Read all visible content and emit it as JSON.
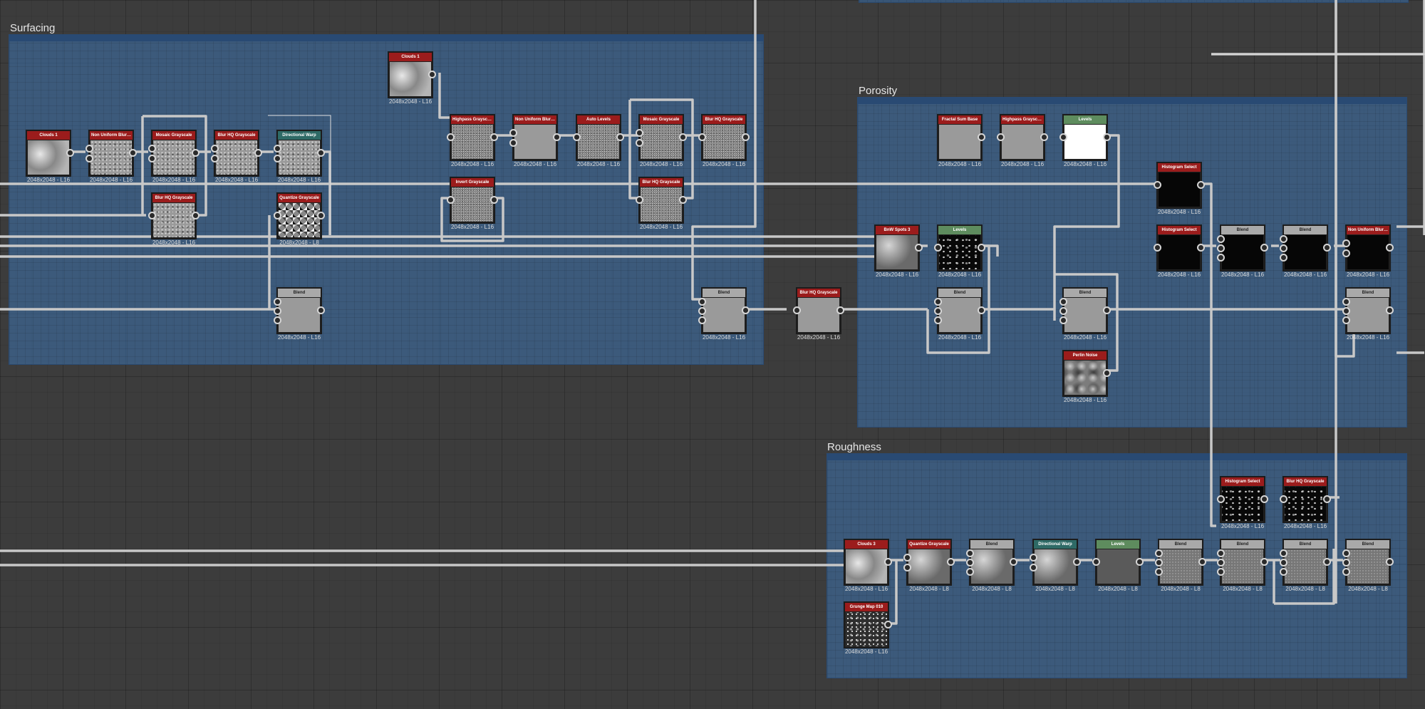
{
  "colors": {
    "canvas_bg": "#3c3c3c",
    "frame_fill": "#3c70a8",
    "wire": "#c8c8c8",
    "header_red": "#9b1c1c",
    "header_green": "#5e8c5e",
    "header_teal": "#2e6a66",
    "header_grey": "#a9a9a9"
  },
  "frames": [
    {
      "id": "surfacing",
      "title": "Surfacing"
    },
    {
      "id": "porosity",
      "title": "Porosity"
    },
    {
      "id": "roughness",
      "title": "Roughness"
    }
  ],
  "nodes": [
    {
      "id": "s_clouds1a",
      "label": "Clouds 1",
      "res": "2048x2048 - L16",
      "header": "red",
      "texture": "clouds"
    },
    {
      "id": "s_nublur1",
      "label": "Non Uniform Blur Grey...",
      "res": "2048x2048 - L16",
      "header": "red",
      "texture": "noise"
    },
    {
      "id": "s_mosaic1",
      "label": "Mosaic Grayscale",
      "res": "2048x2048 - L16",
      "header": "red",
      "texture": "noise"
    },
    {
      "id": "s_blurhq1",
      "label": "Blur HQ Grayscale",
      "res": "2048x2048 - L16",
      "header": "red",
      "texture": "noise"
    },
    {
      "id": "s_dirwarp",
      "label": "Directional Warp",
      "res": "2048x2048 - L16",
      "header": "teal",
      "texture": "noise"
    },
    {
      "id": "s_blurhq2",
      "label": "Blur HQ Grayscale",
      "res": "2048x2048 - L16",
      "header": "red",
      "texture": "noise"
    },
    {
      "id": "s_quantize",
      "label": "Quantize Grayscale",
      "res": "2048x2048 - L8",
      "header": "red",
      "texture": "cells"
    },
    {
      "id": "s_blend1",
      "label": "Blend",
      "res": "2048x2048 - L16",
      "header": "grey",
      "texture": "flat"
    },
    {
      "id": "s_clouds1b",
      "label": "Clouds 1",
      "res": "2048x2048 - L16",
      "header": "red",
      "texture": "clouds"
    },
    {
      "id": "s_highpass",
      "label": "Highpass Grayscale",
      "res": "2048x2048 - L16",
      "header": "red",
      "texture": "fine"
    },
    {
      "id": "s_invert",
      "label": "Invert Grayscale",
      "res": "2048x2048 - L16",
      "header": "red",
      "texture": "fine"
    },
    {
      "id": "s_nublur2",
      "label": "Non Uniform Blur Grey...",
      "res": "2048x2048 - L16",
      "header": "red",
      "texture": "flat"
    },
    {
      "id": "s_autolevels",
      "label": "Auto Levels",
      "res": "2048x2048 - L16",
      "header": "red",
      "texture": "fine"
    },
    {
      "id": "s_mosaic2",
      "label": "Mosaic Grayscale",
      "res": "2048x2048 - L16",
      "header": "red",
      "texture": "fine"
    },
    {
      "id": "s_blurhq3",
      "label": "Blur HQ Grayscale",
      "res": "2048x2048 - L16",
      "header": "red",
      "texture": "fine"
    },
    {
      "id": "s_blurhq4",
      "label": "Blur HQ Grayscale",
      "res": "2048x2048 - L16",
      "header": "red",
      "texture": "fine"
    },
    {
      "id": "s_blend2",
      "label": "Blend",
      "res": "2048x2048 - L16",
      "header": "grey",
      "texture": "flat"
    },
    {
      "id": "m_blurhq",
      "label": "Blur HQ Grayscale",
      "res": "2048x2048 - L16",
      "header": "red",
      "texture": "flat"
    },
    {
      "id": "p_fractal",
      "label": "Fractal Sum Base",
      "res": "2048x2048 - L16",
      "header": "red",
      "texture": "flat"
    },
    {
      "id": "p_highpass",
      "label": "Highpass Grayscale",
      "res": "2048x2048 - L16",
      "header": "red",
      "texture": "flat"
    },
    {
      "id": "p_levels1",
      "label": "Levels",
      "res": "2048x2048 - L16",
      "header": "green",
      "texture": "white"
    },
    {
      "id": "p_bnw",
      "label": "BnW Spots 3",
      "res": "2048x2048 - L16",
      "header": "red",
      "texture": "blotch"
    },
    {
      "id": "p_levels2",
      "label": "Levels",
      "res": "2048x2048 - L16",
      "header": "green",
      "texture": "speck"
    },
    {
      "id": "p_blend1",
      "label": "Blend",
      "res": "2048x2048 - L16",
      "header": "grey",
      "texture": "flat"
    },
    {
      "id": "p_blend2",
      "label": "Blend",
      "res": "2048x2048 - L16",
      "header": "grey",
      "texture": "flat"
    },
    {
      "id": "p_perlin",
      "label": "Perlin Noise",
      "res": "2048x2048 - L16",
      "header": "red",
      "texture": "perlin"
    },
    {
      "id": "p_histsel1",
      "label": "Histogram Select",
      "res": "2048x2048 - L16",
      "header": "red",
      "texture": "black"
    },
    {
      "id": "p_histsel2",
      "label": "Histogram Select",
      "res": "2048x2048 - L16",
      "header": "red",
      "texture": "black"
    },
    {
      "id": "p_blend3",
      "label": "Blend",
      "res": "2048x2048 - L16",
      "header": "grey",
      "texture": "black"
    },
    {
      "id": "p_blend4",
      "label": "Blend",
      "res": "2048x2048 - L16",
      "header": "grey",
      "texture": "black"
    },
    {
      "id": "p_nublur",
      "label": "Non Uniform Blur Grey...",
      "res": "2048x2048 - L16",
      "header": "red",
      "texture": "black"
    },
    {
      "id": "p_blend5",
      "label": "Blend",
      "res": "2048x2048 - L16",
      "header": "grey",
      "texture": "flat"
    },
    {
      "id": "r_clouds3",
      "label": "Clouds 3",
      "res": "2048x2048 - L16",
      "header": "red",
      "texture": "clouds"
    },
    {
      "id": "r_grunge",
      "label": "Grunge Map 010",
      "res": "2048x2048 - L16",
      "header": "red",
      "texture": "grunge"
    },
    {
      "id": "r_quantize",
      "label": "Quantize Grayscale",
      "res": "2048x2048 - L8",
      "header": "red",
      "texture": "blotch"
    },
    {
      "id": "r_blend1",
      "label": "Blend",
      "res": "2048x2048 - L8",
      "header": "grey",
      "texture": "blotch"
    },
    {
      "id": "r_dirwarp",
      "label": "Directional Warp",
      "res": "2048x2048 - L8",
      "header": "teal",
      "texture": "blotch"
    },
    {
      "id": "r_levels",
      "label": "Levels",
      "res": "2048x2048 - L8",
      "header": "green",
      "texture": "dark"
    },
    {
      "id": "r_blend2",
      "label": "Blend",
      "res": "2048x2048 - L8",
      "header": "grey",
      "texture": "grey"
    },
    {
      "id": "r_histsel",
      "label": "Histogram Select",
      "res": "2048x2048 - L16",
      "header": "red",
      "texture": "speck"
    },
    {
      "id": "r_blurhq",
      "label": "Blur HQ Grayscale",
      "res": "2048x2048 - L16",
      "header": "red",
      "texture": "speck"
    },
    {
      "id": "r_blend3",
      "label": "Blend",
      "res": "2048x2048 - L8",
      "header": "grey",
      "texture": "grey"
    },
    {
      "id": "r_blend4",
      "label": "Blend",
      "res": "2048x2048 - L8",
      "header": "grey",
      "texture": "grey"
    },
    {
      "id": "r_blend5",
      "label": "Blend",
      "res": "2048x2048 - L8",
      "header": "grey",
      "texture": "grey"
    }
  ]
}
